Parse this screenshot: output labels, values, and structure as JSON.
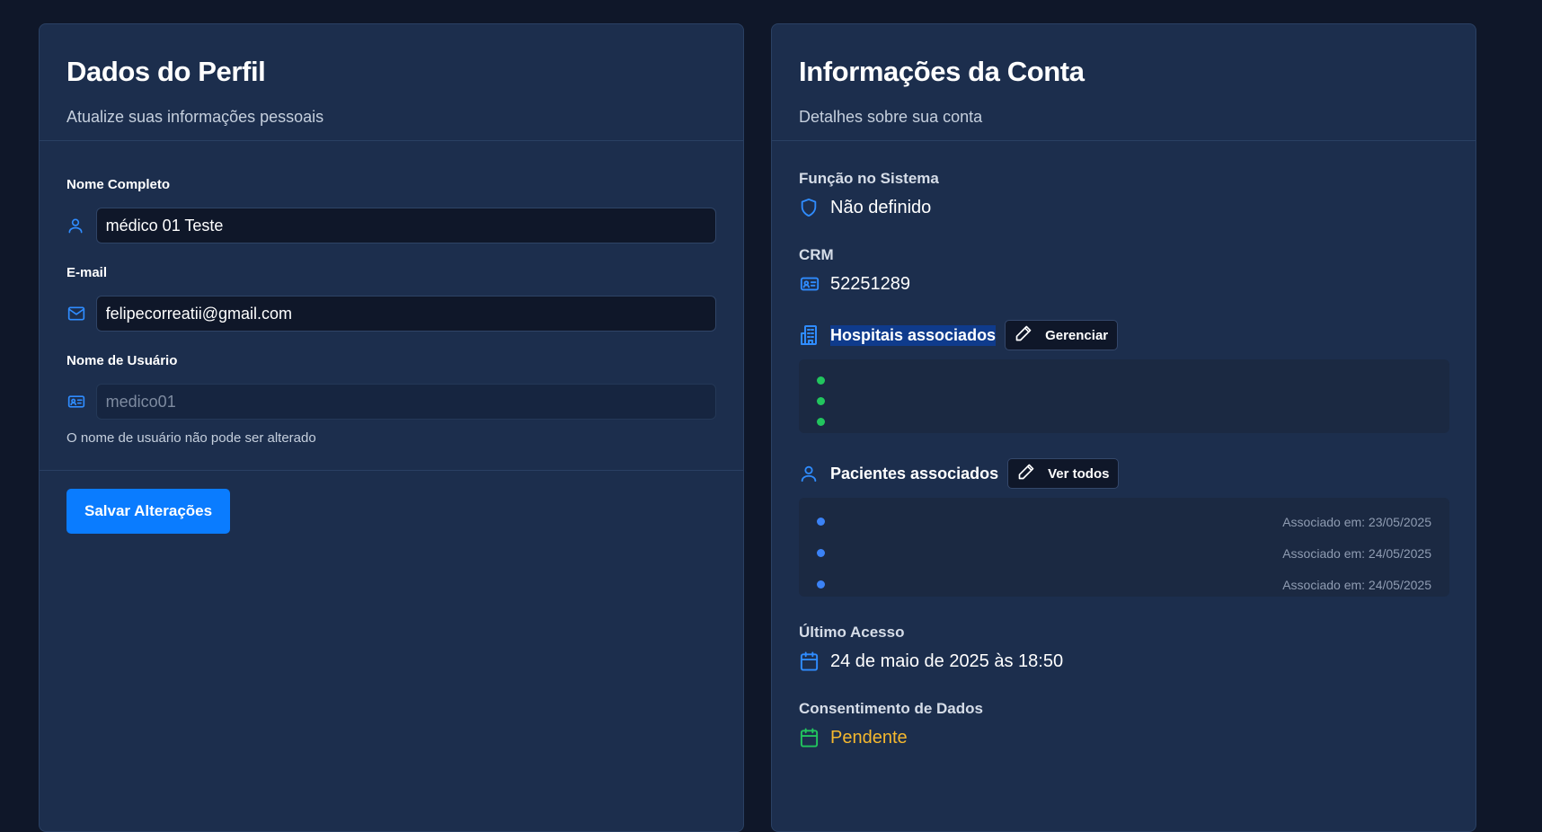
{
  "profile": {
    "title": "Dados do Perfil",
    "description": "Atualize suas informações pessoais",
    "full_name_label": "Nome Completo",
    "full_name_value": "médico 01 Teste",
    "email_label": "E-mail",
    "email_value": "felipecorreatii@gmail.com",
    "username_label": "Nome de Usuário",
    "username_value": "medico01",
    "username_hint": "O nome de usuário não pode ser alterado",
    "save_label": "Salvar Alterações"
  },
  "account": {
    "title": "Informações da Conta",
    "description": "Detalhes sobre sua conta",
    "role_label": "Função no Sistema",
    "role_value": "Não definido",
    "crm_label": "CRM",
    "crm_value": "52251289",
    "hospitals_label": "Hospitais associados",
    "hospitals_button": "Gerenciar",
    "hospitals": [
      "",
      "",
      ""
    ],
    "patients_label": "Pacientes associados",
    "patients_button": "Ver todos",
    "patients": [
      {
        "name": "",
        "date": "Associado em: 23/05/2025"
      },
      {
        "name": "",
        "date": "Associado em: 24/05/2025"
      },
      {
        "name": "",
        "date": "Associado em: 24/05/2025"
      }
    ],
    "last_access_label": "Último Acesso",
    "last_access_value": "24 de maio de 2025 às 18:50",
    "consent_label": "Consentimento de Dados",
    "consent_value": "Pendente"
  },
  "colors": {
    "background": "#0f1729",
    "card": "#1c2e4d",
    "accent": "#0a7cff",
    "icon_blue": "#2f8cff",
    "status_green": "#22c55e",
    "status_blue": "#3b82f6",
    "pending_amber": "#f5b82e"
  },
  "icons": {
    "full_name": "user-icon",
    "email": "mail-icon",
    "username": "id-card-icon",
    "role": "shield-icon",
    "crm": "id-card-icon",
    "hospitals": "building-icon",
    "patients": "user-icon",
    "edit": "pencil-icon",
    "last_access": "calendar-icon",
    "consent": "calendar-icon"
  }
}
